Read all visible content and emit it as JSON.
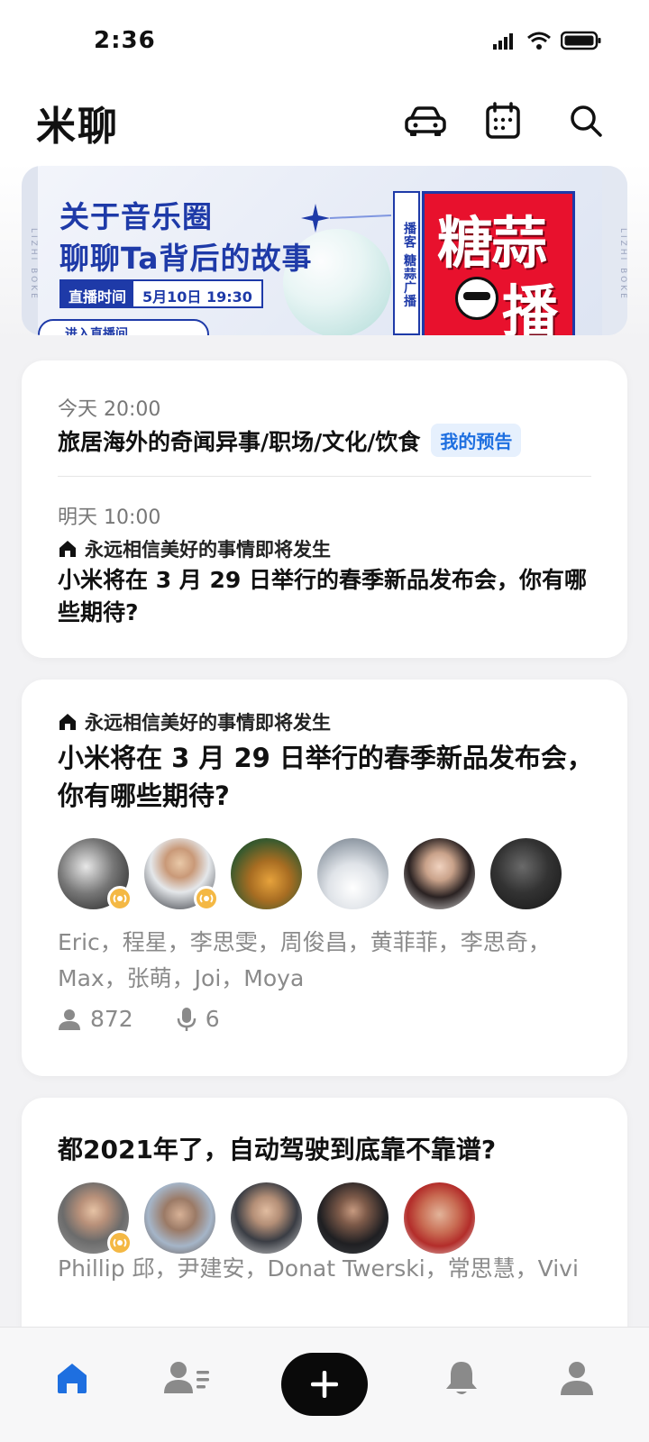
{
  "status_bar": {
    "time": "2:36"
  },
  "header": {
    "title": "米聊"
  },
  "banner": {
    "line1": "关于音乐圈",
    "line2": "聊聊Ta背后的故事",
    "time_label": "直播时间",
    "time_value": "5月10日 19:30",
    "enter_label": "进入直播间",
    "strip_text": "播客 糖蒜广播",
    "poster_top": "糖蒜",
    "poster_bottom": "播",
    "side_text": "LIZHI BOKE"
  },
  "schedule_card": {
    "item1_time": "今天 20:00",
    "item1_title": "旅居海外的奇闻异事/职场/文化/饮食",
    "item1_badge": "我的预告",
    "item2_time": "明天 10:00",
    "item2_club": "永远相信美好的事情即将发生",
    "item2_title": "小米将在 3 月 29 日举行的春季新品发布会，你有哪些期待?"
  },
  "room_card_1": {
    "club": "永远相信美好的事情即将发生",
    "title": "小米将在 3 月 29 日举行的春季新品发布会，你有哪些期待?",
    "names": "Eric，程星，李思雯，周俊昌，黄菲菲，李思奇，Max，张萌，Joi，Moya",
    "listeners": "872",
    "speakers": "6"
  },
  "room_card_2": {
    "title": "都2021年了，自动驾驶到底靠不靠谱?",
    "names": "Phillip 邱，尹建安，Donat Twerski，常思慧，Vivi"
  },
  "colors": {
    "accent": "#1e6fe0",
    "live_badge": "#f4b844",
    "banner_blue": "#1e3aa8",
    "poster_red": "#e8112d"
  }
}
